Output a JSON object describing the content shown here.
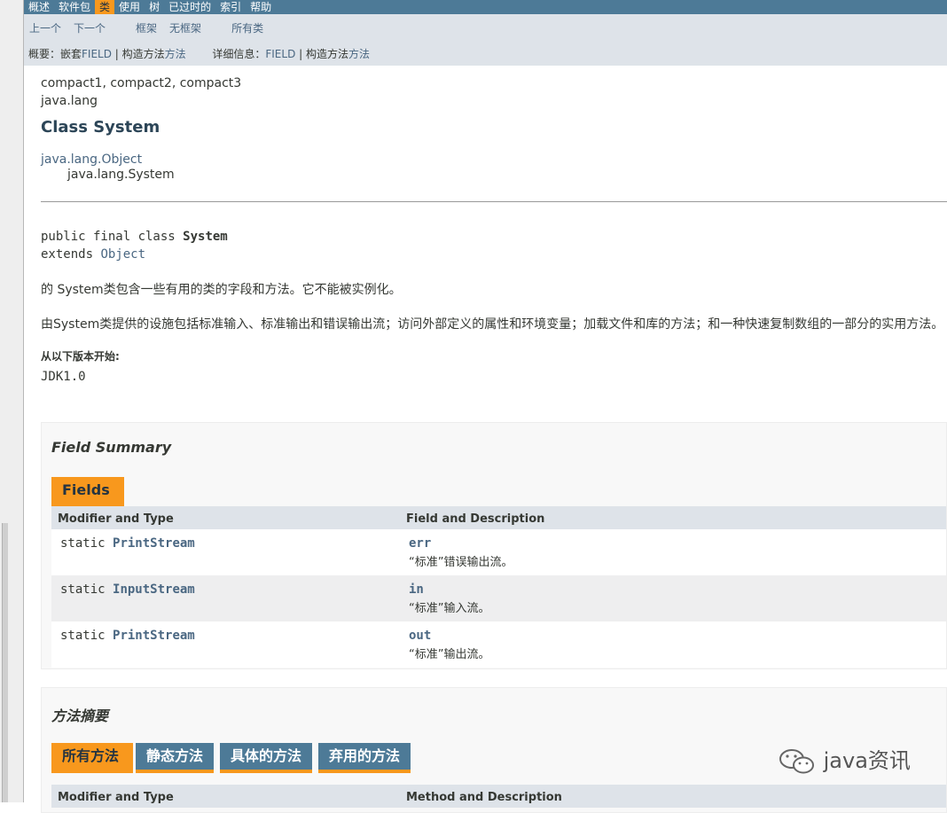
{
  "topnav": [
    "概述",
    "软件包",
    "类",
    "使用",
    "树",
    "已过时的",
    "索引",
    "帮助"
  ],
  "subnav": {
    "prev": "上一个",
    "next": "下一个",
    "frames": "框架",
    "noframes": "无框架",
    "allclasses": "所有类",
    "summary_label": "概要：",
    "summary_nested": "嵌套",
    "summary_field": "FIELD",
    "summary_sep": " | ",
    "summary_constr": "构造方法",
    "summary_method": "方法",
    "detail_label": "详细信息：",
    "detail_field": "FIELD",
    "detail_sep": " | ",
    "detail_constr": "构造方法",
    "detail_method": "方法"
  },
  "header": {
    "profiles": "compact1, compact2, compact3",
    "package": "java.lang",
    "title": "Class System",
    "inherit_parent": "java.lang.Object",
    "inherit_child": "java.lang.System"
  },
  "decl": {
    "line1_pre": "public final class ",
    "line1_name": "System",
    "line2_pre": "extends ",
    "line2_link": "Object"
  },
  "description": {
    "p1": "的 System类包含一些有用的类的字段和方法。它不能被实例化。",
    "p2": "由System类提供的设施包括标准输入、标准输出和错误输出流；访问外部定义的属性和环境变量；加载文件和库的方法；和一种快速复制数组的一部分的实用方法。",
    "since_label": "从以下版本开始:",
    "since_value": "JDK1.0"
  },
  "field_summary": {
    "heading": "Field Summary",
    "tab": "Fields",
    "col1": "Modifier and Type",
    "col2": "Field and Description",
    "rows": [
      {
        "mod": "static ",
        "type": "PrintStream",
        "name": "err",
        "desc": "“标准”错误输出流。"
      },
      {
        "mod": "static ",
        "type": "InputStream",
        "name": "in",
        "desc": "“标准”输入流。"
      },
      {
        "mod": "static ",
        "type": "PrintStream",
        "name": "out",
        "desc": "“标准”输出流。"
      }
    ]
  },
  "method_summary": {
    "heading": "方法摘要",
    "tabs": [
      "所有方法",
      "静态方法",
      "具体的方法",
      "弃用的方法"
    ],
    "col1": "Modifier and Type",
    "col2": "Method and Description"
  },
  "watermark": "java资讯",
  "colors": {
    "nav": "#4d7a97",
    "accent": "#f8981d",
    "subnav": "#dee3e9"
  }
}
